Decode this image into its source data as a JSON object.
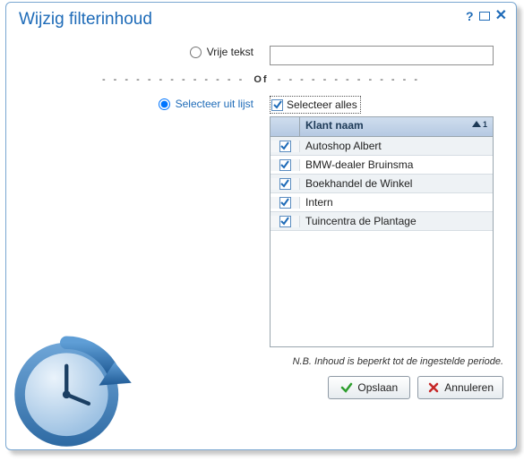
{
  "title": "Wijzig filterinhoud",
  "radios": {
    "free_text": "Vrije tekst",
    "select_from_list": "Selecteer uit lijst"
  },
  "free_text_value": "",
  "separator_word": "Of",
  "select_all_label": "Selecteer alles",
  "select_all_checked": true,
  "grid": {
    "header": "Klant naam",
    "sort_index": "1",
    "rows": [
      {
        "checked": true,
        "name": "Autoshop Albert"
      },
      {
        "checked": true,
        "name": "BMW-dealer Bruinsma"
      },
      {
        "checked": true,
        "name": "Boekhandel de Winkel"
      },
      {
        "checked": true,
        "name": "Intern"
      },
      {
        "checked": true,
        "name": "Tuincentra de Plantage"
      }
    ]
  },
  "note": "N.B. Inhoud is beperkt tot de ingestelde periode.",
  "buttons": {
    "save": "Opslaan",
    "cancel": "Annuleren"
  }
}
